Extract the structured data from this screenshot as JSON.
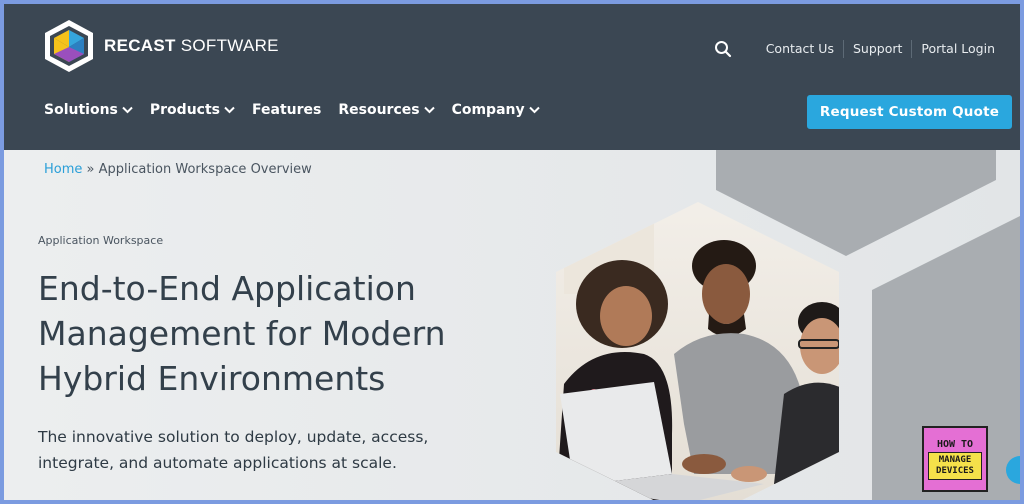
{
  "brand": {
    "logo_bold": "RECAST",
    "logo_light": " SOFTWARE"
  },
  "utility_nav": [
    {
      "label": "Contact Us"
    },
    {
      "label": "Support"
    },
    {
      "label": "Portal Login"
    }
  ],
  "main_nav": [
    {
      "label": "Solutions",
      "has_dropdown": true
    },
    {
      "label": "Products",
      "has_dropdown": true
    },
    {
      "label": "Features",
      "has_dropdown": false
    },
    {
      "label": "Resources",
      "has_dropdown": true
    },
    {
      "label": "Company",
      "has_dropdown": true
    }
  ],
  "cta": {
    "label": "Request Custom Quote"
  },
  "breadcrumb": {
    "home": "Home",
    "separator": " » ",
    "current": "Application Workspace Overview"
  },
  "hero": {
    "eyebrow": "Application Workspace",
    "headline": "End-to-End Application Management for Modern Hybrid Environments",
    "subhead": "The innovative solution to deploy, update, access, integrate, and automate applications at scale."
  },
  "watermark": {
    "line1": "HOW TO",
    "line2": "MANAGE",
    "line3": "DEVICES"
  },
  "colors": {
    "header_bg": "#3b4753",
    "accent": "#2aa7de",
    "hero_bg": "#eef0f1",
    "hex_gray": "#a9adb1",
    "frame": "#7b9be0"
  },
  "icons": {
    "search": "search-icon",
    "chevron": "chevron-down-icon",
    "logo": "recast-hexagon-logo"
  }
}
